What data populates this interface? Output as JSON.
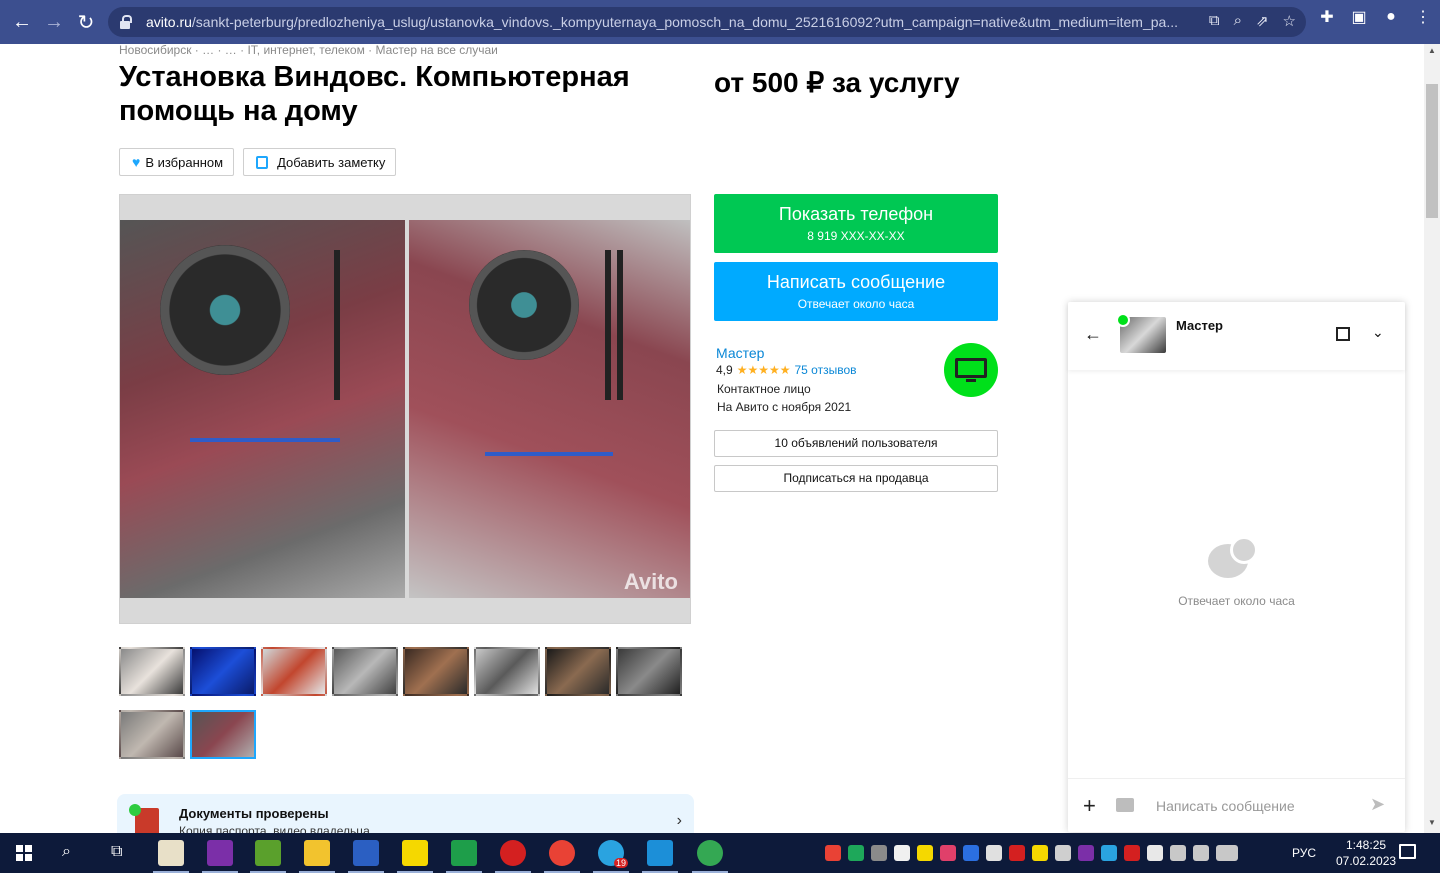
{
  "browser": {
    "url_host": "avito.ru",
    "url_path": "/sankt-peterburg/predlozheniya_uslug/ustanovka_vindovs._kompyuternaya_pomosch_na_domu_2521616092?utm_campaign=native&utm_medium=item_pa...",
    "icons": [
      "back-icon",
      "forward-icon",
      "reload-icon",
      "lock-icon",
      "translate-icon",
      "zoom-icon",
      "share-icon",
      "bookmark-star-icon",
      "extensions-icon",
      "sidebar-icon",
      "profile-icon",
      "menu-icon"
    ]
  },
  "breadcrumb": "Новосибирск · … · … · IT, интернет, телеком · Мастер на все случаи",
  "listing": {
    "title": "Установка Виндовс. Компьютерная помощь на дому",
    "price": "от 500 ₽ за услугу",
    "favorite_label": "В избранном",
    "note_label": "Добавить заметку",
    "watermark": "Avito",
    "thumbnail_count": 10,
    "selected_thumbnail": 10
  },
  "documents": {
    "title": "Документы проверены",
    "subtitle": "Копия паспорта, видео владельца"
  },
  "contact": {
    "phone_label": "Показать телефон",
    "phone_masked": "8 919 XXX-XX-XX",
    "message_label": "Написать сообщение",
    "message_sub": "Отвечает около часа"
  },
  "seller": {
    "name": "Мастер",
    "rating": "4,9",
    "stars": "★★★★★",
    "reviews": "75 отзывов",
    "role": "Контактное лицо",
    "since": "На Авито с ноября 2021",
    "listings_label": "10 объявлений пользователя",
    "subscribe_label": "Подписаться на продавца"
  },
  "chat": {
    "name": "Мастер",
    "empty_text": "Отвечает около часа",
    "input_placeholder": "Написать сообщение"
  },
  "taskbar": {
    "lang": "РУС",
    "time": "1:48:25",
    "date": "07.02.2023",
    "telegram_badge": "19"
  },
  "colors": {
    "browser_bar": "#3c4f8f",
    "phone_button": "#00c853",
    "message_button": "#00aaff",
    "link": "#0a87d6",
    "online": "#00e01a"
  }
}
